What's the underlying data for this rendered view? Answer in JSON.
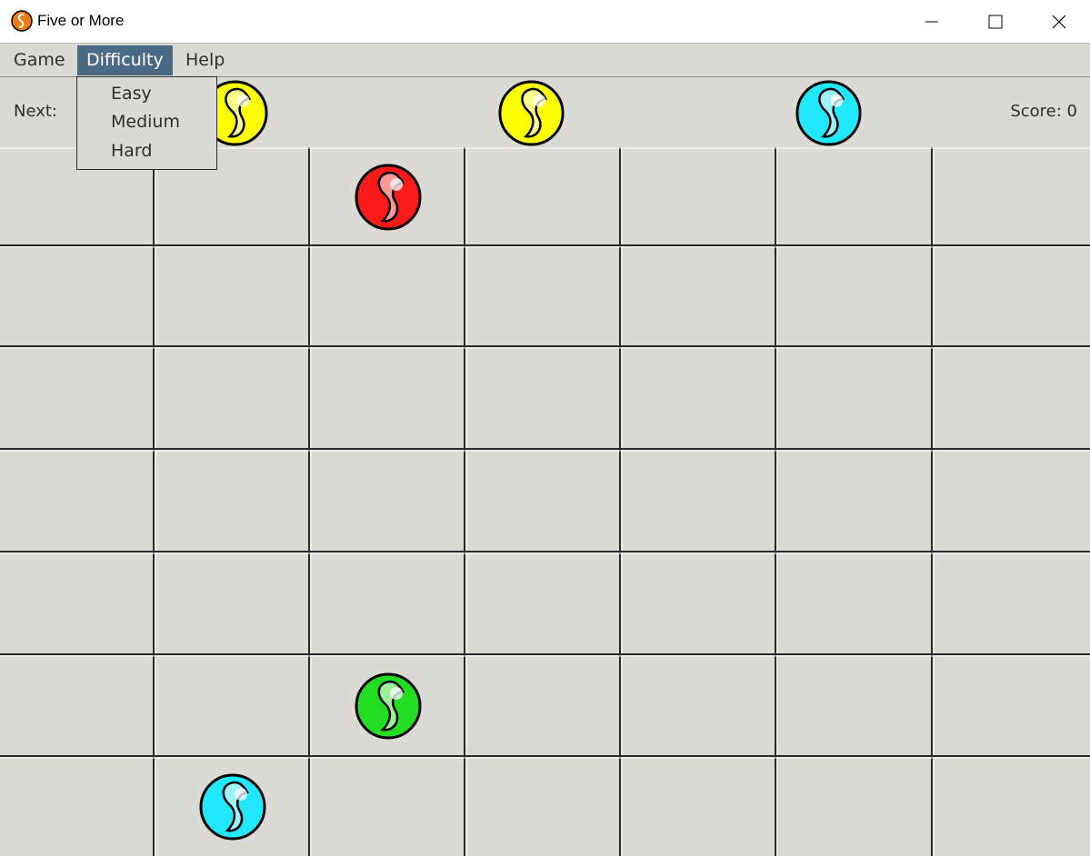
{
  "window": {
    "title": "Five or More"
  },
  "menu": {
    "game": "Game",
    "difficulty": "Difficulty",
    "help": "Help"
  },
  "difficulty_menu": {
    "items": [
      "Easy",
      "Medium",
      "Hard"
    ]
  },
  "status": {
    "next_label": "Next:",
    "score_label": "Score: 0"
  },
  "colors": {
    "yellow": "#ffff00",
    "cyan": "#22e8ff",
    "red": "#ff1a1a",
    "green": "#22dd22",
    "menu_highlight": "#4a6984",
    "board_bg": "#dcdad5"
  },
  "next_balls": [
    "yellow",
    "yellow",
    "cyan"
  ],
  "board": {
    "columns": 7,
    "rows": 7,
    "balls": [
      {
        "row": 0,
        "col": 2,
        "color": "red"
      },
      {
        "row": 5,
        "col": 2,
        "color": "green"
      },
      {
        "row": 6,
        "col": 1,
        "color": "cyan"
      }
    ]
  }
}
